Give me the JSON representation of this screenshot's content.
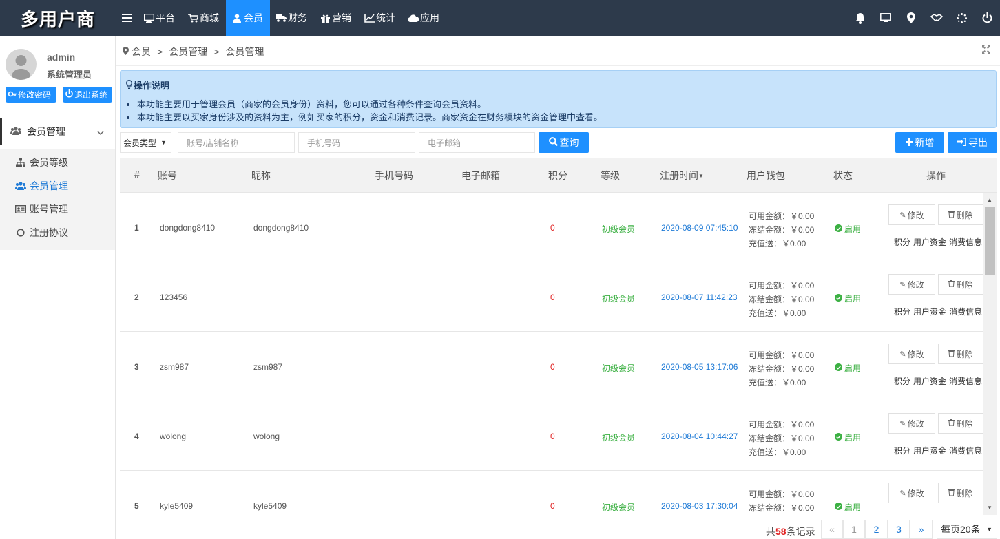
{
  "app": {
    "logo": "多用户商"
  },
  "nav": [
    {
      "label": "平台",
      "icon": "monitor-icon"
    },
    {
      "label": "商城",
      "icon": "cart-icon"
    },
    {
      "label": "会员",
      "icon": "user-icon",
      "active": true
    },
    {
      "label": "财务",
      "icon": "truck-icon"
    },
    {
      "label": "营销",
      "icon": "gift-icon"
    },
    {
      "label": "统计",
      "icon": "chart-icon"
    },
    {
      "label": "应用",
      "icon": "cloud-icon"
    }
  ],
  "user": {
    "name": "admin",
    "role": "系统管理员",
    "change_pwd": "修改密码",
    "logout": "退出系统"
  },
  "sidebar": {
    "group": "会员管理",
    "items": [
      {
        "label": "会员等级",
        "icon": "sitemap-icon"
      },
      {
        "label": "会员管理",
        "icon": "users-icon",
        "active": true
      },
      {
        "label": "账号管理",
        "icon": "id-card-icon"
      },
      {
        "label": "注册协议",
        "icon": "circle-icon"
      }
    ]
  },
  "breadcrumb": [
    "会员",
    "会员管理",
    "会员管理"
  ],
  "notice": {
    "title": "操作说明",
    "lines": [
      "本功能主要用于管理会员（商家的会员身份）资料，您可以通过各种条件查询会员资料。",
      "本功能主要以买家身份涉及的资料为主，例如买家的积分，资金和消费记录。商家资金在财务模块的资金管理中查看。"
    ]
  },
  "filters": {
    "member_type": "会员类型",
    "account_placeholder": "账号/店铺名称",
    "phone_placeholder": "手机号码",
    "email_placeholder": "电子邮箱",
    "query": "查询",
    "add": "新增",
    "export": "导出"
  },
  "table": {
    "headers": [
      "#",
      "账号",
      "昵称",
      "手机号码",
      "电子邮箱",
      "积分",
      "等级",
      "注册时间",
      "用户钱包",
      "状态",
      "操作"
    ],
    "rows": [
      {
        "idx": "1",
        "account": "dongdong8410",
        "nick": "dongdong8410",
        "points": "0",
        "level": "初级会员",
        "time": "2020-08-09 07:45:10",
        "avail": "可用金额：￥0.00",
        "frozen": "冻结金额：￥0.00",
        "gift": "充值送：￥0.00",
        "status": "启用"
      },
      {
        "idx": "2",
        "account": "123456",
        "nick": "",
        "points": "0",
        "level": "初级会员",
        "time": "2020-08-07 11:42:23",
        "avail": "可用金额：￥0.00",
        "frozen": "冻结金额：￥0.00",
        "gift": "充值送：￥0.00",
        "status": "启用"
      },
      {
        "idx": "3",
        "account": "zsm987",
        "nick": "zsm987",
        "points": "0",
        "level": "初级会员",
        "time": "2020-08-05 13:17:06",
        "avail": "可用金额：￥0.00",
        "frozen": "冻结金额：￥0.00",
        "gift": "充值送：￥0.00",
        "status": "启用"
      },
      {
        "idx": "4",
        "account": "wolong",
        "nick": "wolong",
        "points": "0",
        "level": "初级会员",
        "time": "2020-08-04 10:44:27",
        "avail": "可用金额：￥0.00",
        "frozen": "冻结金额：￥0.00",
        "gift": "充值送：￥0.00",
        "status": "启用"
      },
      {
        "idx": "5",
        "account": "kyle5409",
        "nick": "kyle5409",
        "points": "0",
        "level": "初级会员",
        "time": "2020-08-03 17:30:04",
        "avail": "可用金额：￥0.00",
        "frozen": "冻结金额：￥0.00",
        "gift": "",
        "status": "启用"
      }
    ],
    "actions": {
      "edit": "修改",
      "delete": "删除",
      "points": "积分",
      "funds": "用户资金",
      "consume": "消费信息"
    }
  },
  "pagination": {
    "total_prefix": "共",
    "total": "58",
    "total_suffix": "条记录",
    "prev": "«",
    "pages": [
      "1",
      "2",
      "3"
    ],
    "next": "»",
    "page_size": "每页20条"
  },
  "colors": {
    "topbar": "#2d3a4b",
    "accent": "#1e90ff",
    "notice_bg": "#c7e3fb",
    "points": "#e02020",
    "level": "#3cb043"
  }
}
